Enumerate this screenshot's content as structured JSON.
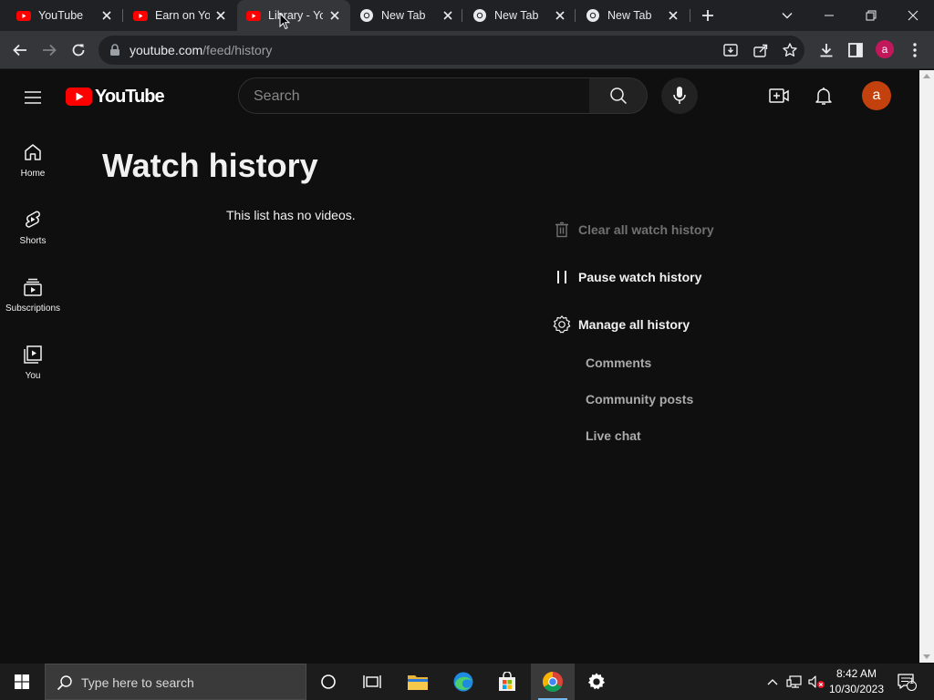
{
  "browser": {
    "tabs": [
      {
        "title": "YouTube",
        "icon": "youtube-icon"
      },
      {
        "title": "Earn on YouTube",
        "icon": "youtube-icon"
      },
      {
        "title": "Library - YouTube",
        "icon": "youtube-icon"
      },
      {
        "title": "New Tab",
        "icon": "chrome-icon"
      },
      {
        "title": "New Tab",
        "icon": "chrome-icon"
      },
      {
        "title": "New Tab",
        "icon": "chrome-icon"
      }
    ],
    "url_host": "youtube.com",
    "url_path": "/feed/history",
    "profile_initial": "a"
  },
  "youtube": {
    "logo_text": "YouTube",
    "search_placeholder": "Search",
    "avatar_initial": "a",
    "guide": [
      {
        "label": "Home",
        "icon": "home-icon"
      },
      {
        "label": "Shorts",
        "icon": "shorts-icon"
      },
      {
        "label": "Subscriptions",
        "icon": "subscriptions-icon"
      },
      {
        "label": "You",
        "icon": "you-icon"
      }
    ],
    "page_title": "Watch history",
    "empty_message": "This list has no videos.",
    "actions": {
      "clear": "Clear all watch history",
      "pause": "Pause watch history",
      "manage": "Manage all history"
    },
    "sub_links": [
      "Comments",
      "Community posts",
      "Live chat"
    ]
  },
  "taskbar": {
    "search_placeholder": "Type here to search",
    "time": "8:42 AM",
    "date": "10/30/2023",
    "notification_count": "1"
  },
  "colors": {
    "youtube_red": "#ff0000",
    "page_bg": "#0f0f0f",
    "chrome_toolbar": "#35363a",
    "avatar": "#c2410c"
  }
}
